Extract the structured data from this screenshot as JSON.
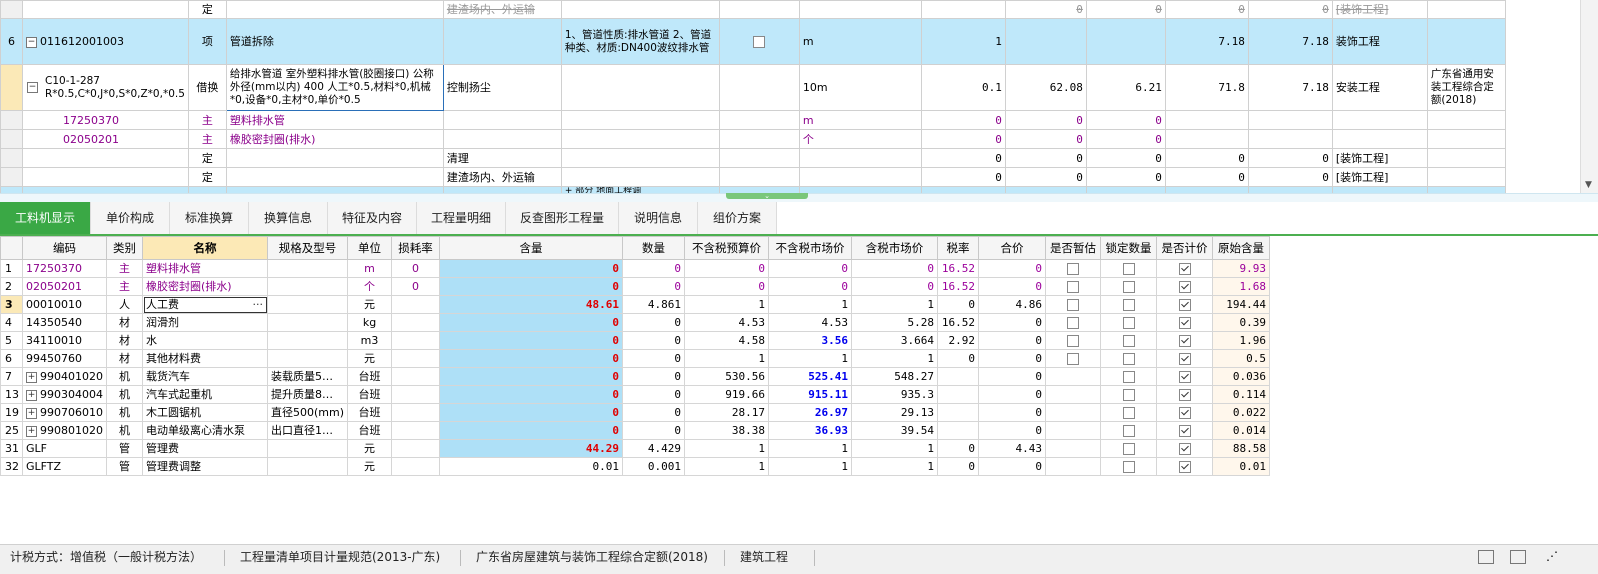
{
  "upper_rows": [
    {
      "num": "",
      "code": "",
      "type": "定",
      "name": "",
      "feature": "建渣场内、外运输",
      "spec": "",
      "unit": "",
      "qty": "",
      "p1": "0",
      "p2": "0",
      "p3": "0",
      "p4": "0",
      "prof": "[装饰工程]",
      "std": "",
      "strike": true
    },
    {
      "num": "6",
      "code": "011612001003",
      "type": "项",
      "name": "管道拆除",
      "feature": "",
      "spec": "1、管道性质:排水管道 2、管道种类、材质:DN400波纹排水管",
      "unit": "m",
      "qty": "1",
      "p1": "",
      "p2": "",
      "p3": "7.18",
      "p4": "7.18",
      "prof": "装饰工程",
      "std": ""
    },
    {
      "num": "",
      "code": "C10-1-287 R*0.5,C*0,J*0,S*0,Z*0,*0.5",
      "type": "借换",
      "name": "给排水管道 室外塑料排水管(胶圈接口) 公称外径(mm以内) 400 人工*0.5,材料*0,机械*0,设备*0,主材*0,单价*0.5",
      "feature": "控制扬尘",
      "spec": "",
      "unit": "10m",
      "qty": "0.1",
      "p1": "62.08",
      "p2": "6.21",
      "p3": "71.8",
      "p4": "7.18",
      "prof": "安装工程",
      "std": "广东省通用安装工程综合定额(2018)"
    },
    {
      "num": "",
      "code": "17250370",
      "type": "主",
      "name": "塑料排水管",
      "feature": "",
      "spec": "",
      "unit": "m",
      "qty": "0",
      "p1": "0",
      "p2": "0",
      "p3": "",
      "p4": "",
      "prof": "",
      "std": ""
    },
    {
      "num": "",
      "code": "02050201",
      "type": "主",
      "name": "橡胶密封圈(排水)",
      "feature": "",
      "spec": "",
      "unit": "个",
      "qty": "0",
      "p1": "0",
      "p2": "0",
      "p3": "",
      "p4": "",
      "prof": "",
      "std": ""
    },
    {
      "num": "",
      "code": "",
      "type": "定",
      "name": "",
      "feature": "清理",
      "spec": "",
      "unit": "",
      "qty": "0",
      "p1": "0",
      "p2": "0",
      "p3": "0",
      "p4": "0",
      "prof": "[装饰工程]",
      "std": ""
    },
    {
      "num": "",
      "code": "",
      "type": "定",
      "name": "",
      "feature": "建渣场内、外运输",
      "spec": "",
      "unit": "",
      "qty": "0",
      "p1": "0",
      "p2": "0",
      "p3": "0",
      "p4": "0",
      "prof": "[装饰工程]",
      "std": ""
    },
    {
      "num": "",
      "code": "",
      "type": "",
      "name": "",
      "feature": "",
      "spec": "+ 部分 地面工程调",
      "unit": "",
      "qty": "",
      "p1": "",
      "p2": "",
      "p3": "",
      "p4": "",
      "prof": "",
      "std": ""
    }
  ],
  "tabs": [
    "工料机显示",
    "单价构成",
    "标准换算",
    "换算信息",
    "特征及内容",
    "工程量明细",
    "反查图形工程量",
    "说明信息",
    "组价方案"
  ],
  "lower_headers": [
    "",
    "编码",
    "类别",
    "名称",
    "规格及型号",
    "单位",
    "损耗率",
    "含量",
    "数量",
    "不含税预算价",
    "不含税市场价",
    "含税市场价",
    "税率",
    "合价",
    "是否暂估",
    "锁定数量",
    "是否计价",
    "原始含量"
  ],
  "lower_rows": [
    {
      "rn": "1",
      "code": "17250370",
      "cat": "主",
      "name": "塑料排水管",
      "spec": "",
      "unit": "m",
      "loss": "0",
      "content": "0",
      "qty": "0",
      "p1": "0",
      "p2": "0",
      "p3": "0",
      "tax": "16.52",
      "total": "0",
      "est": false,
      "lock": false,
      "priced": true,
      "orig": "9.93",
      "purple": true,
      "tree": false
    },
    {
      "rn": "2",
      "code": "02050201",
      "cat": "主",
      "name": "橡胶密封圈(排水)",
      "spec": "",
      "unit": "个",
      "loss": "0",
      "content": "0",
      "qty": "0",
      "p1": "0",
      "p2": "0",
      "p3": "0",
      "tax": "16.52",
      "total": "0",
      "est": false,
      "lock": false,
      "priced": true,
      "orig": "1.68",
      "purple": true,
      "tree": false
    },
    {
      "rn": "3",
      "code": "00010010",
      "cat": "人",
      "name": "人工费",
      "spec": "",
      "unit": "元",
      "loss": "",
      "content": "48.61",
      "qty": "4.861",
      "p1": "1",
      "p2": "1",
      "p3": "1",
      "tax": "0",
      "total": "4.86",
      "est": false,
      "lock": false,
      "priced": true,
      "orig": "194.44",
      "purple": false,
      "tree": false,
      "current": true
    },
    {
      "rn": "4",
      "code": "14350540",
      "cat": "材",
      "name": "润滑剂",
      "spec": "",
      "unit": "kg",
      "loss": "",
      "content": "0",
      "qty": "0",
      "p1": "4.53",
      "p2": "4.53",
      "p3": "5.28",
      "tax": "16.52",
      "total": "0",
      "est": false,
      "lock": false,
      "priced": true,
      "orig": "0.39",
      "purple": false,
      "tree": false
    },
    {
      "rn": "5",
      "code": "34110010",
      "cat": "材",
      "name": "水",
      "spec": "",
      "unit": "m3",
      "loss": "",
      "content": "0",
      "qty": "0",
      "p1": "4.58",
      "p2": "3.56",
      "p3": "3.664",
      "tax": "2.92",
      "total": "0",
      "est": false,
      "lock": false,
      "priced": true,
      "orig": "1.96",
      "purple": false,
      "tree": false,
      "bluep2": true
    },
    {
      "rn": "6",
      "code": "99450760",
      "cat": "材",
      "name": "其他材料费",
      "spec": "",
      "unit": "元",
      "loss": "",
      "content": "0",
      "qty": "0",
      "p1": "1",
      "p2": "1",
      "p3": "1",
      "tax": "0",
      "total": "0",
      "est": false,
      "lock": false,
      "priced": true,
      "orig": "0.5",
      "purple": false,
      "tree": false
    },
    {
      "rn": "7",
      "code": "990401020",
      "cat": "机",
      "name": "载货汽车",
      "spec": "装载质量5…",
      "unit": "台班",
      "loss": "",
      "content": "0",
      "qty": "0",
      "p1": "530.56",
      "p2": "525.41",
      "p3": "548.27",
      "tax": "",
      "total": "0",
      "est": null,
      "lock": false,
      "priced": true,
      "orig": "0.036",
      "purple": false,
      "tree": true,
      "bluep2": true
    },
    {
      "rn": "13",
      "code": "990304004",
      "cat": "机",
      "name": "汽车式起重机",
      "spec": "提升质量8…",
      "unit": "台班",
      "loss": "",
      "content": "0",
      "qty": "0",
      "p1": "919.66",
      "p2": "915.11",
      "p3": "935.3",
      "tax": "",
      "total": "0",
      "est": null,
      "lock": false,
      "priced": true,
      "orig": "0.114",
      "purple": false,
      "tree": true,
      "bluep2": true
    },
    {
      "rn": "19",
      "code": "990706010",
      "cat": "机",
      "name": "木工圆锯机",
      "spec": "直径500(mm)",
      "unit": "台班",
      "loss": "",
      "content": "0",
      "qty": "0",
      "p1": "28.17",
      "p2": "26.97",
      "p3": "29.13",
      "tax": "",
      "total": "0",
      "est": null,
      "lock": false,
      "priced": true,
      "orig": "0.022",
      "purple": false,
      "tree": true,
      "bluep2": true
    },
    {
      "rn": "25",
      "code": "990801020",
      "cat": "机",
      "name": "电动单级离心清水泵",
      "spec": "出口直径1…",
      "unit": "台班",
      "loss": "",
      "content": "0",
      "qty": "0",
      "p1": "38.38",
      "p2": "36.93",
      "p3": "39.54",
      "tax": "",
      "total": "0",
      "est": null,
      "lock": false,
      "priced": true,
      "orig": "0.014",
      "purple": false,
      "tree": true,
      "bluep2": true
    },
    {
      "rn": "31",
      "code": "GLF",
      "cat": "管",
      "name": "管理费",
      "spec": "",
      "unit": "元",
      "loss": "",
      "content": "44.29",
      "qty": "4.429",
      "p1": "1",
      "p2": "1",
      "p3": "1",
      "tax": "0",
      "total": "4.43",
      "est": null,
      "lock": false,
      "priced": true,
      "orig": "88.58",
      "purple": false,
      "tree": false
    },
    {
      "rn": "32",
      "code": "GLFTZ",
      "cat": "管",
      "name": "管理费调整",
      "spec": "",
      "unit": "元",
      "loss": "",
      "content": "0.01",
      "qty": "0.001",
      "p1": "1",
      "p2": "1",
      "p3": "1",
      "tax": "0",
      "total": "0",
      "est": null,
      "lock": false,
      "priced": true,
      "orig": "0.01",
      "purple": false,
      "tree": false,
      "plain": true
    }
  ],
  "edit_ellipsis": "···",
  "status": {
    "tax_method": "计税方式：增值税（一般计税方法）",
    "spec": "工程量清单项目计量规范(2013-广东)",
    "quota": "广东省房屋建筑与装饰工程综合定额(2018)",
    "profession": "建筑工程"
  },
  "colors": {
    "accent": "#3aa845",
    "selected_row": "#bfe8fa",
    "content_col": "#aee0f7",
    "red": "#e00000",
    "blue": "#0000ee",
    "purple": "#8b008b"
  },
  "icons": [
    "collapse-tree-icon",
    "checkbox-icon",
    "checked-icon",
    "expand-tree-icon",
    "scroll-down-arrow-icon",
    "view-icon",
    "list-icon",
    "grip-icon"
  ]
}
